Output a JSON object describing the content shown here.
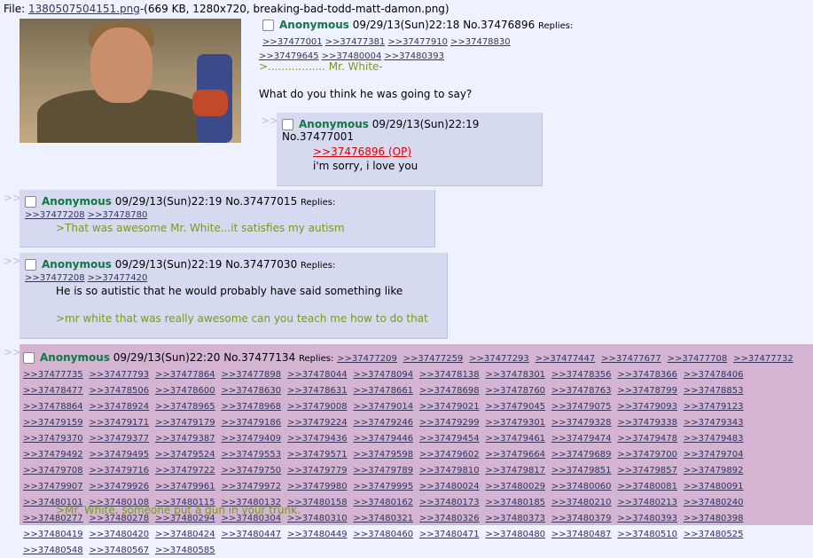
{
  "file": {
    "label": "File: ",
    "filename": "1380507504151.png",
    "info": "-(669 KB, 1280x720, breaking-bad-todd-matt-damon.png)"
  },
  "op": {
    "name": "Anonymous",
    "datetime": "09/29/13(Sun)22:18",
    "no": "No.37476896",
    "replies_label": "Replies:",
    "replies": [
      ">>37477001",
      ">>37477381",
      ">>37477910",
      ">>37478830",
      ">>37479645",
      ">>37480004",
      ">>37480393"
    ],
    "line1": ">................. Mr. White-",
    "line2": "What do you think he was going to say?"
  },
  "posts": [
    {
      "name": "Anonymous",
      "datetime": "09/29/13(Sun)22:19",
      "no": "No.37477001",
      "quote": ">>37476896 (OP)",
      "text": "i'm sorry, i love you"
    },
    {
      "name": "Anonymous",
      "datetime": "09/29/13(Sun)22:19",
      "no": "No.37477015",
      "replies_label": "Replies:",
      "replies": [
        ">>37477208",
        ">>37478780"
      ],
      "text": ">That was awesome Mr. White...it satisfies my autism"
    },
    {
      "name": "Anonymous",
      "datetime": "09/29/13(Sun)22:19",
      "no": "No.37477030",
      "replies_label": "Replies:",
      "replies": [
        ">>37477208",
        ">>37477420"
      ],
      "text": "He is so autistic that he would probably have said something like",
      "green": ">mr white that was really awesome can you teach me how to do that"
    },
    {
      "name": "Anonymous",
      "datetime": "09/29/13(Sun)22:20",
      "no": "No.37477134",
      "replies_label": "Replies:",
      "replies": [
        ">>37477209",
        ">>37477259",
        ">>37477293",
        ">>37477447",
        ">>37477677",
        ">>37477708",
        ">>37477732",
        ">>37477735",
        ">>37477793",
        ">>37477864",
        ">>37477898",
        ">>37478044",
        ">>37478094",
        ">>37478138",
        ">>37478301",
        ">>37478356",
        ">>37478366",
        ">>37478406",
        ">>37478477",
        ">>37478506",
        ">>37478600",
        ">>37478630",
        ">>37478631",
        ">>37478661",
        ">>37478698",
        ">>37478760",
        ">>37478763",
        ">>37478799",
        ">>37478853",
        ">>37478864",
        ">>37478924",
        ">>37478965",
        ">>37478968",
        ">>37479008",
        ">>37479014",
        ">>37479021",
        ">>37479045",
        ">>37479075",
        ">>37479093",
        ">>37479123",
        ">>37479159",
        ">>37479171",
        ">>37479179",
        ">>37479186",
        ">>37479224",
        ">>37479246",
        ">>37479299",
        ">>37479301",
        ">>37479328",
        ">>37479338",
        ">>37479343",
        ">>37479370",
        ">>37479377",
        ">>37479387",
        ">>37479409",
        ">>37479436",
        ">>37479446",
        ">>37479454",
        ">>37479461",
        ">>37479474",
        ">>37479478",
        ">>37479483",
        ">>37479492",
        ">>37479495",
        ">>37479524",
        ">>37479553",
        ">>37479571",
        ">>37479598",
        ">>37479602",
        ">>37479664",
        ">>37479689",
        ">>37479700",
        ">>37479704",
        ">>37479708",
        ">>37479716",
        ">>37479722",
        ">>37479750",
        ">>37479779",
        ">>37479789",
        ">>37479810",
        ">>37479817",
        ">>37479851",
        ">>37479857",
        ">>37479892",
        ">>37479907",
        ">>37479926",
        ">>37479961",
        ">>37479972",
        ">>37479980",
        ">>37479995",
        ">>37480024",
        ">>37480029",
        ">>37480060",
        ">>37480081",
        ">>37480091",
        ">>37480101",
        ">>37480108",
        ">>37480115",
        ">>37480132",
        ">>37480158",
        ">>37480162",
        ">>37480173",
        ">>37480185",
        ">>37480210",
        ">>37480213",
        ">>37480240",
        ">>37480277",
        ">>37480278",
        ">>37480294",
        ">>37480304",
        ">>37480310",
        ">>37480321",
        ">>37480326",
        ">>37480373",
        ">>37480379",
        ">>37480393",
        ">>37480398",
        ">>37480419",
        ">>37480420",
        ">>37480424",
        ">>37480447",
        ">>37480449",
        ">>37480460",
        ">>37480471",
        ">>37480480",
        ">>37480487",
        ">>37480510",
        ">>37480525",
        ">>37480548",
        ">>37480567",
        ">>37480585"
      ],
      "text": ">Mr. White, someone put a gun in your trunk."
    }
  ],
  "side_arrows": ">>",
  "colors": {
    "name": "#117743",
    "greentext": "#789922",
    "reply_bg": "#d6daf0",
    "highlight_bg": "#d5b4d1",
    "deadlink": "#dd0000"
  }
}
